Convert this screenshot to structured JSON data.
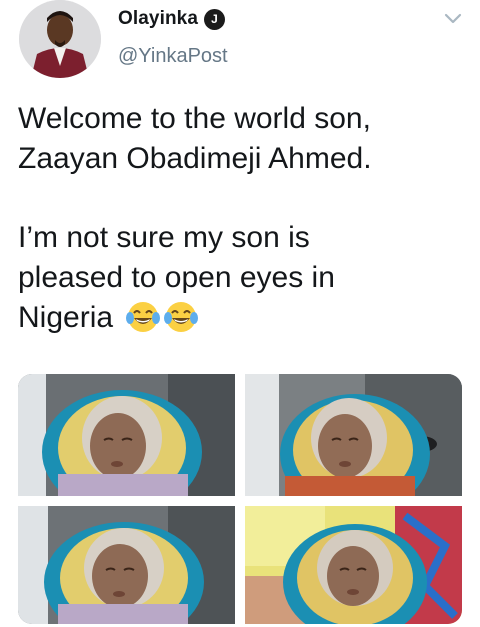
{
  "author": {
    "display_name": "Olayinka",
    "handle": "@YinkaPost",
    "badge_letter": "J"
  },
  "tweet": {
    "line_1": "Welcome to the world son,",
    "line_2": "Zaayan Obadimeji Ahmed.",
    "line_3": "I’m not sure my son is",
    "line_4": "pleased to open eyes in",
    "line_5": "Nigeria"
  },
  "emoji": [
    "face-with-tears-of-joy",
    "face-with-tears-of-joy"
  ],
  "icons": {
    "menu": "chevron-down-icon",
    "verified": "verified-badge-icon"
  },
  "colors": {
    "text": "#14171a",
    "secondary": "#657786",
    "badge": "#1b1b1b"
  },
  "media": {
    "count": 4,
    "subject": "newborn baby wrapped in patterned blanket"
  }
}
